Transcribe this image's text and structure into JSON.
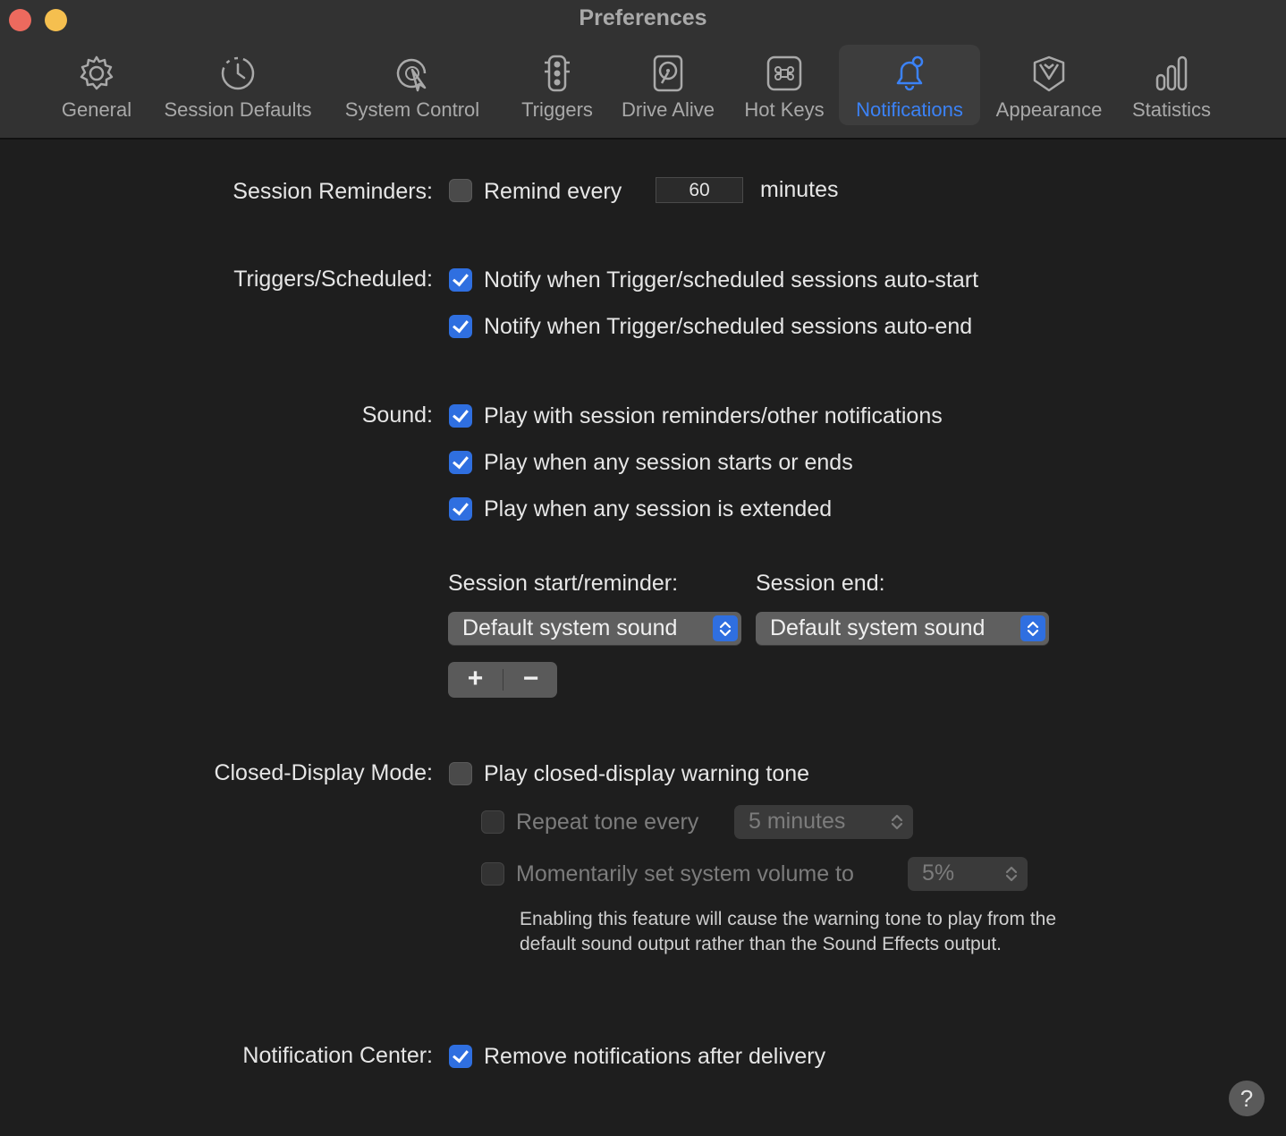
{
  "window": {
    "title": "Preferences"
  },
  "tabs": [
    {
      "label": "General",
      "icon": "gear-icon"
    },
    {
      "label": "Session Defaults",
      "icon": "clock-dashed-icon"
    },
    {
      "label": "System Control",
      "icon": "cursor-click-icon"
    },
    {
      "label": "Triggers",
      "icon": "traffic-light-icon"
    },
    {
      "label": "Drive Alive",
      "icon": "hard-drive-icon"
    },
    {
      "label": "Hot Keys",
      "icon": "command-key-icon"
    },
    {
      "label": "Notifications",
      "icon": "bell-icon",
      "active": true
    },
    {
      "label": "Appearance",
      "icon": "tuxedo-icon"
    },
    {
      "label": "Statistics",
      "icon": "bar-chart-icon"
    }
  ],
  "accent_color": "#2f6fe0",
  "reminders": {
    "label": "Session Reminders:",
    "checked": false,
    "text": "Remind every",
    "value": "60",
    "unit": "minutes"
  },
  "triggers": {
    "label": "Triggers/Scheduled:",
    "items": [
      {
        "text": "Notify when Trigger/scheduled sessions auto-start",
        "checked": true
      },
      {
        "text": "Notify when Trigger/scheduled sessions auto-end",
        "checked": true
      }
    ]
  },
  "sound": {
    "label": "Sound:",
    "items": [
      {
        "text": "Play with session reminders/other notifications",
        "checked": true
      },
      {
        "text": "Play when any session starts or ends",
        "checked": true
      },
      {
        "text": "Play when any session is extended",
        "checked": true
      }
    ],
    "start_label": "Session start/reminder:",
    "start_value": "Default system sound",
    "end_label": "Session end:",
    "end_value": "Default system sound",
    "add_label": "+",
    "remove_label": "−"
  },
  "closed_display": {
    "label": "Closed-Display Mode:",
    "warning": {
      "text": "Play closed-display warning tone",
      "checked": false
    },
    "repeat": {
      "text": "Repeat tone every",
      "checked": false,
      "value": "5 minutes"
    },
    "volume": {
      "text": "Momentarily set system volume to",
      "checked": false,
      "value": "5%"
    },
    "note": "Enabling this feature will cause the warning tone to play from the default sound output rather than the Sound Effects output."
  },
  "notification_center": {
    "label": "Notification Center:",
    "text": "Remove notifications after delivery",
    "checked": true
  },
  "help": {
    "label": "?"
  }
}
